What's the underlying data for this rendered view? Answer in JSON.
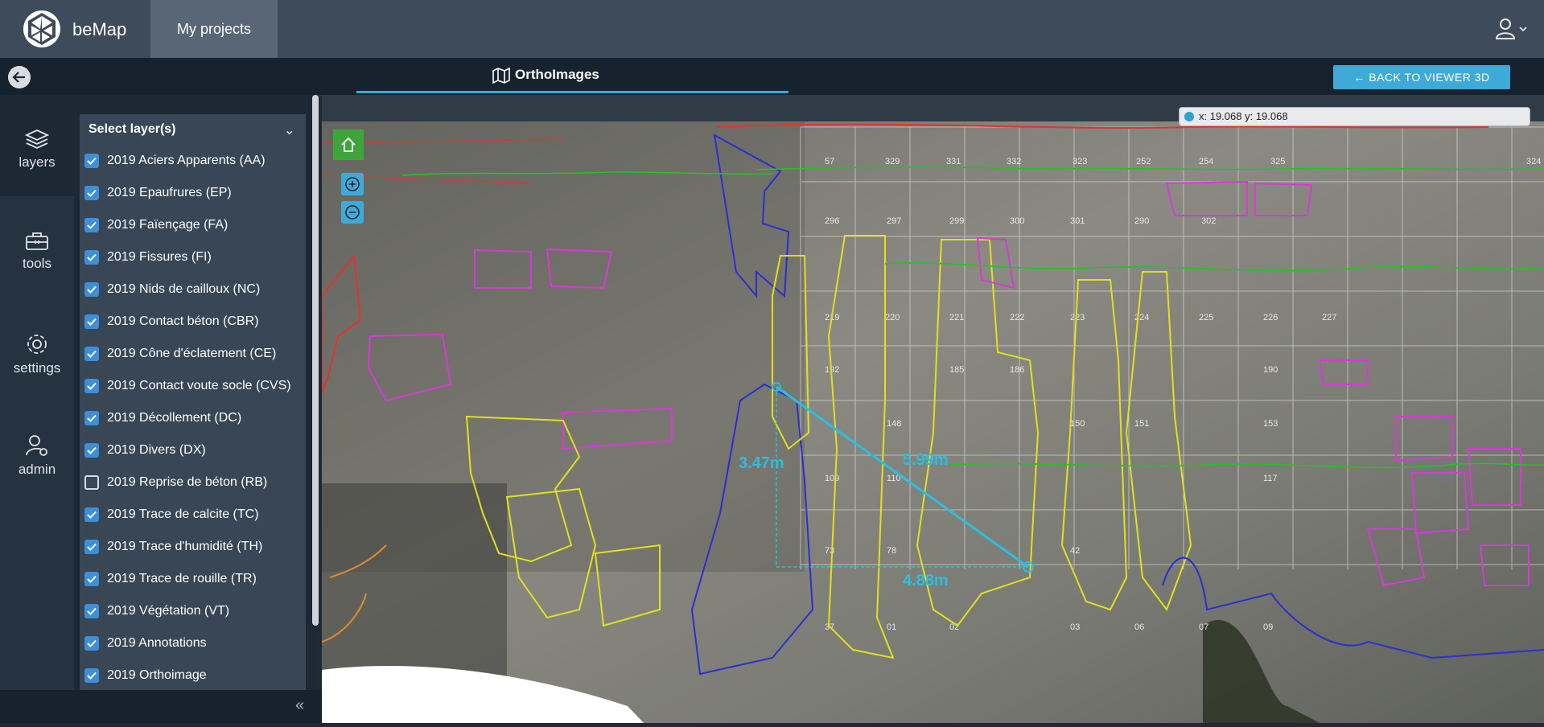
{
  "header": {
    "app_name": "beMap",
    "nav_tab": "My projects"
  },
  "subheader": {
    "title": "OrthoImages",
    "back_button": "BACK TO VIEWER 3D"
  },
  "rail": {
    "items": [
      {
        "label": "layers",
        "icon": "layers-icon"
      },
      {
        "label": "tools",
        "icon": "toolbox-icon"
      },
      {
        "label": "settings",
        "icon": "gear-icon"
      },
      {
        "label": "admin",
        "icon": "user-gear-icon"
      }
    ]
  },
  "layers": {
    "header": "Select layer(s)",
    "items": [
      {
        "label": "2019 Aciers Apparents (AA)",
        "checked": true
      },
      {
        "label": "2019 Epaufrures (EP)",
        "checked": true
      },
      {
        "label": "2019 Faïençage (FA)",
        "checked": true
      },
      {
        "label": "2019 Fissures (FI)",
        "checked": true
      },
      {
        "label": "2019 Nids de cailloux (NC)",
        "checked": true
      },
      {
        "label": "2019 Contact béton (CBR)",
        "checked": true
      },
      {
        "label": "2019 Cône d'éclatement (CE)",
        "checked": true
      },
      {
        "label": "2019 Contact voute socle (CVS)",
        "checked": true
      },
      {
        "label": "2019 Décollement (DC)",
        "checked": true
      },
      {
        "label": "2019 Divers (DX)",
        "checked": true
      },
      {
        "label": "2019 Reprise de béton (RB)",
        "checked": false
      },
      {
        "label": "2019 Trace de calcite (TC)",
        "checked": true
      },
      {
        "label": "2019 Trace d'humidité (TH)",
        "checked": true
      },
      {
        "label": "2019 Trace de rouille (TR)",
        "checked": true
      },
      {
        "label": "2019 Végétation (VT)",
        "checked": true
      },
      {
        "label": "2019 Annotations",
        "checked": true
      },
      {
        "label": "2019 Orthoimage",
        "checked": true
      }
    ]
  },
  "viewer": {
    "coords": "x: 19.068 y: 19.068",
    "measurements": {
      "diagonal": "5.99m",
      "vertical": "3.47m",
      "horizontal": "4.88m"
    },
    "grid_labels": [
      "57",
      "329",
      "331",
      "332",
      "323",
      "252",
      "254",
      "325",
      "324",
      "296",
      "297",
      "299",
      "300",
      "301",
      "290",
      "302",
      "219",
      "220",
      "221",
      "222",
      "223",
      "224",
      "225",
      "226",
      "227",
      "192",
      "185",
      "186",
      "190",
      "148",
      "150",
      "151",
      "153",
      "109",
      "110",
      "117",
      "73",
      "78",
      "42",
      "37",
      "01",
      "02",
      "03",
      "06",
      "07",
      "09"
    ]
  },
  "colors": {
    "accent": "#3faad8",
    "topbar": "#3e4b5b",
    "checkbox": "#3d8fd8"
  }
}
